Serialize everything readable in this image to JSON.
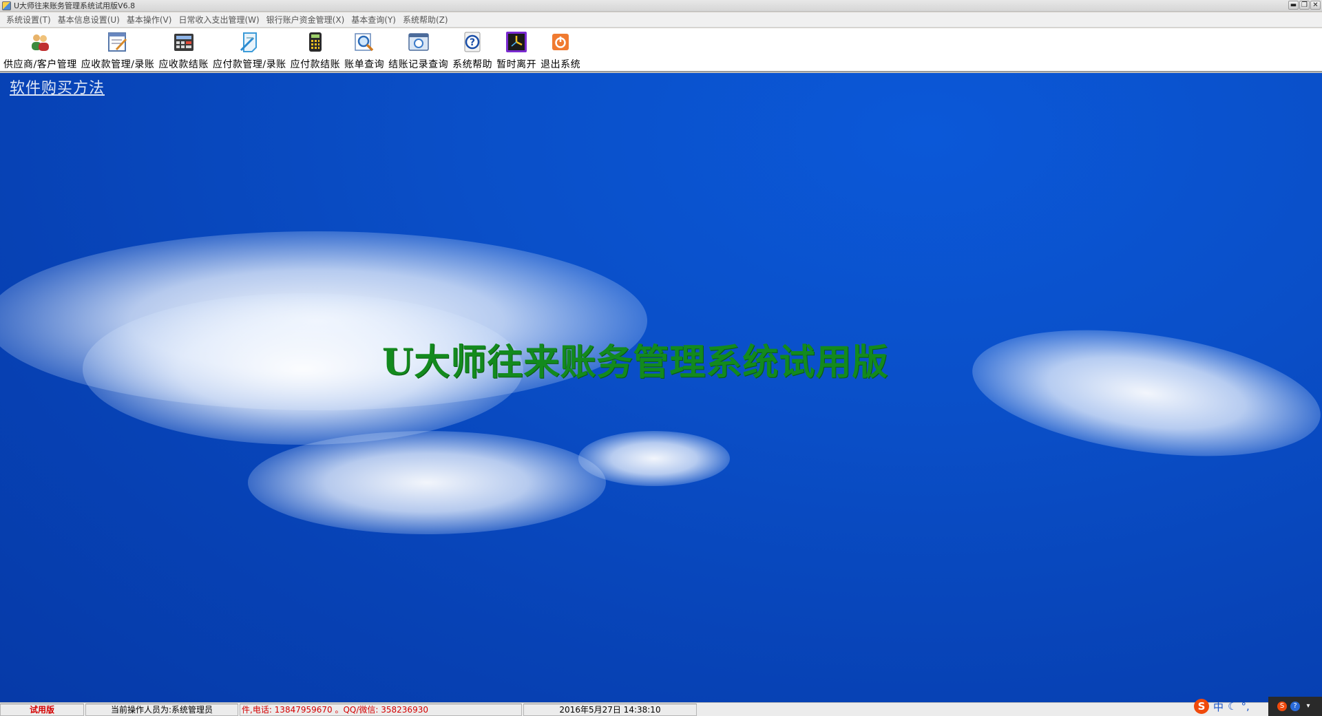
{
  "window": {
    "title": "U大师往来账务管理系统试用版V6.8",
    "controls": {
      "minimize": "▬",
      "restore": "❐",
      "close": "✕"
    }
  },
  "menubar": [
    "系统设置(T)",
    "基本信息设置(U)",
    "基本操作(V)",
    "日常收入支出管理(W)",
    "银行账户资金管理(X)",
    "基本查询(Y)",
    "系统帮助(Z)"
  ],
  "toolbar": [
    {
      "label": "供应商/客户管理",
      "icon": "users-icon"
    },
    {
      "label": "应收款管理/录账",
      "icon": "ledger-edit-icon"
    },
    {
      "label": "应收款结账",
      "icon": "calculator-icon"
    },
    {
      "label": "应付款管理/录账",
      "icon": "pen-document-icon"
    },
    {
      "label": "应付款结账",
      "icon": "calculator-yellow-icon"
    },
    {
      "label": "账单查询",
      "icon": "magnifier-icon"
    },
    {
      "label": "结账记录查询",
      "icon": "window-search-icon"
    },
    {
      "label": "系统帮助",
      "icon": "help-icon"
    },
    {
      "label": "暂时离开",
      "icon": "clock-icon"
    },
    {
      "label": "退出系统",
      "icon": "power-icon"
    }
  ],
  "main": {
    "buy_link": "软件购买方法",
    "center_title": "U大师往来账务管理系统试用版"
  },
  "statusbar": {
    "version": "试用版",
    "operator": "当前操作人员为:系统管理员",
    "contact": "件,电话: 13847959670 。QQ/微信: 358236930",
    "datetime": "2016年5月27日  14:38:10"
  },
  "tray": {
    "ime_logo": "S",
    "ime_mode": "中",
    "punct": "°,"
  },
  "colors": {
    "sky": "#0a4fc8",
    "title_green": "#138a1e",
    "status_red": "#d40000"
  }
}
